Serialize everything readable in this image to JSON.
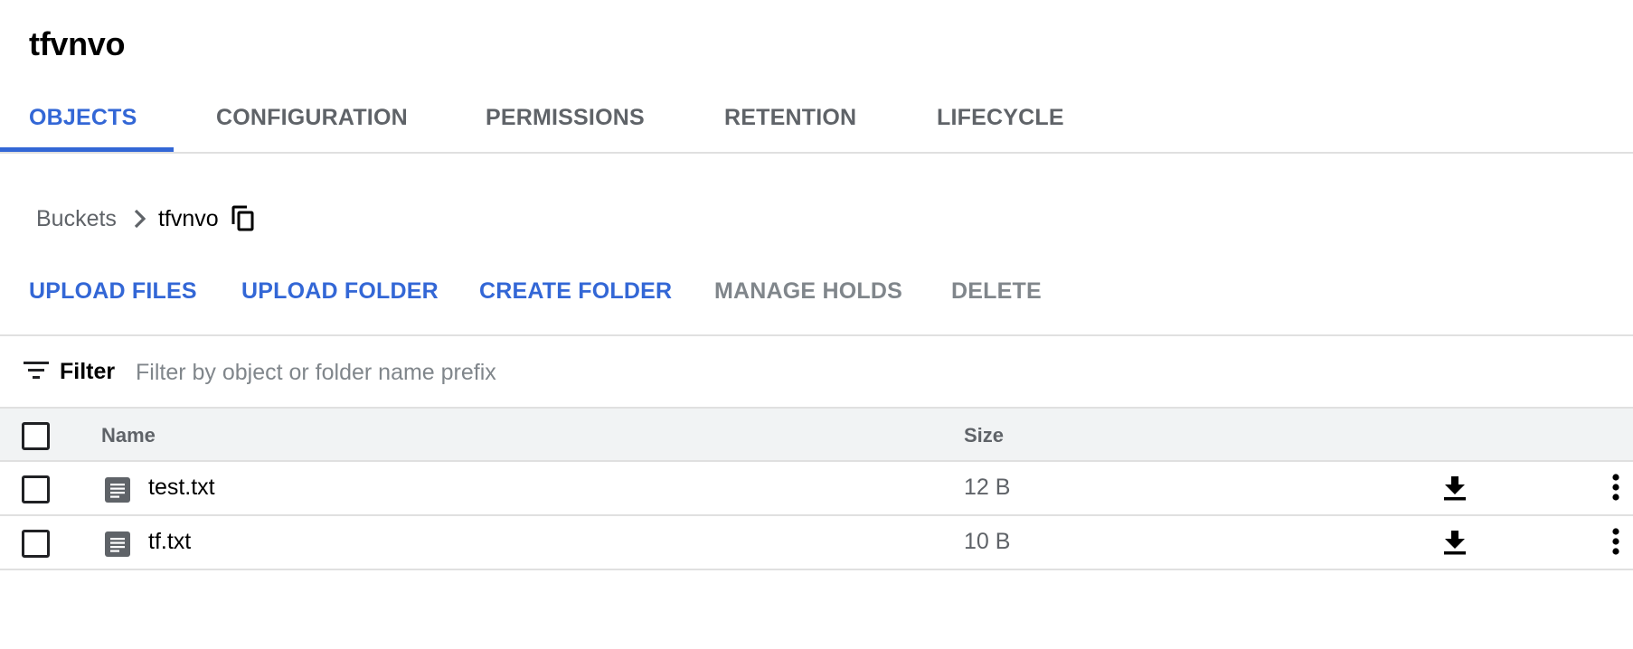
{
  "bucket": {
    "title": "tfvnvo"
  },
  "tabs": [
    {
      "label": "OBJECTS",
      "active": true
    },
    {
      "label": "CONFIGURATION",
      "active": false
    },
    {
      "label": "PERMISSIONS",
      "active": false
    },
    {
      "label": "RETENTION",
      "active": false
    },
    {
      "label": "LIFECYCLE",
      "active": false
    }
  ],
  "breadcrumb": {
    "root": "Buckets",
    "current": "tfvnvo",
    "separator_icon": "chevron-right-icon",
    "copy_icon": "copy-icon"
  },
  "actions": [
    {
      "label": "UPLOAD FILES",
      "enabled": true
    },
    {
      "label": "UPLOAD FOLDER",
      "enabled": true
    },
    {
      "label": "CREATE FOLDER",
      "enabled": true
    },
    {
      "label": "MANAGE HOLDS",
      "enabled": false
    },
    {
      "label": "DELETE",
      "enabled": false
    }
  ],
  "filter": {
    "label": "Filter",
    "placeholder": "Filter by object or folder name prefix",
    "value": "",
    "icon": "filter-list-icon"
  },
  "table": {
    "columns": {
      "name": "Name",
      "size": "Size"
    },
    "rows": [
      {
        "name": "test.txt",
        "size": "12 B",
        "icon": "text-file-icon",
        "checked": false
      },
      {
        "name": "tf.txt",
        "size": "10 B",
        "icon": "text-file-icon",
        "checked": false
      }
    ]
  },
  "colors": {
    "accent": "#3367d6",
    "disabled": "#80868b",
    "header_bg": "#f1f3f4",
    "divider": "#e0e0e0"
  }
}
